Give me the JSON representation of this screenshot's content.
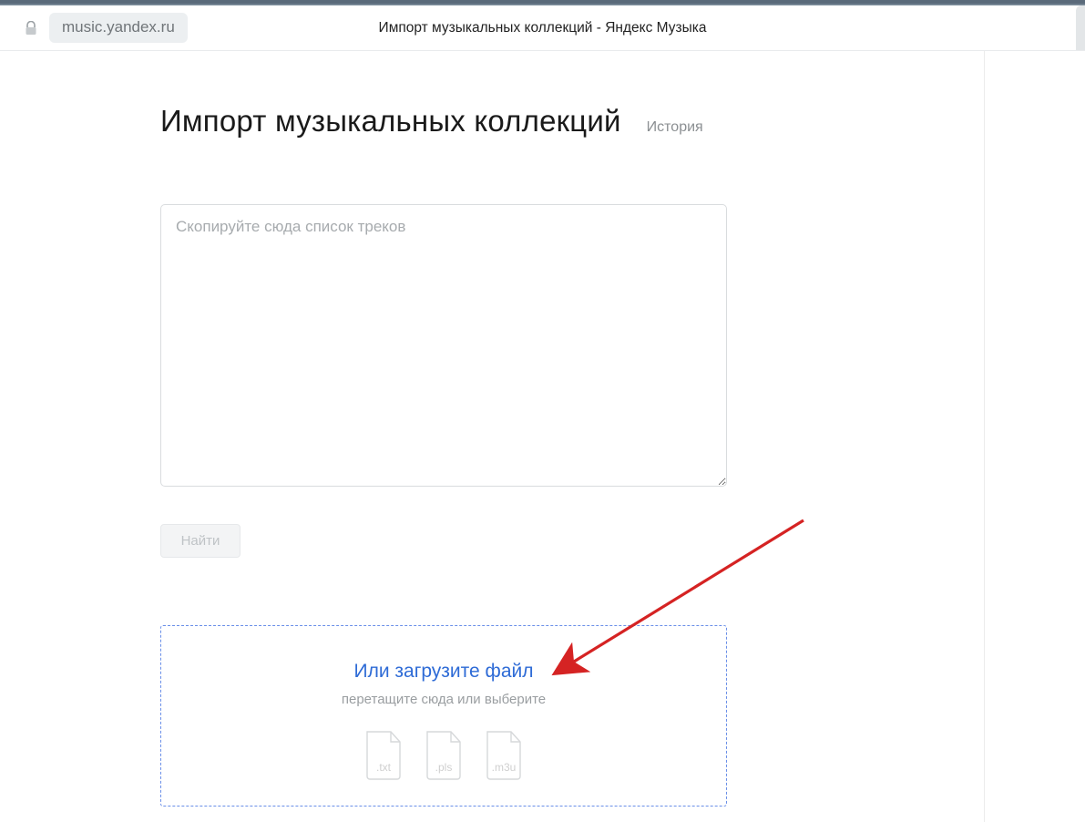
{
  "browser": {
    "url": "music.yandex.ru",
    "tab_title": "Импорт музыкальных коллекций - Яндекс Музыка"
  },
  "header": {
    "title": "Импорт музыкальных коллекций",
    "history_link": "История"
  },
  "import": {
    "textarea_placeholder": "Скопируйте сюда список треков",
    "find_button": "Найти"
  },
  "dropzone": {
    "title": "Или загрузите файл",
    "subtitle": "перетащите сюда или выберите",
    "file_types": [
      ".txt",
      ".pls",
      ".m3u"
    ]
  },
  "annotation": {
    "arrow_color": "#d52323"
  }
}
